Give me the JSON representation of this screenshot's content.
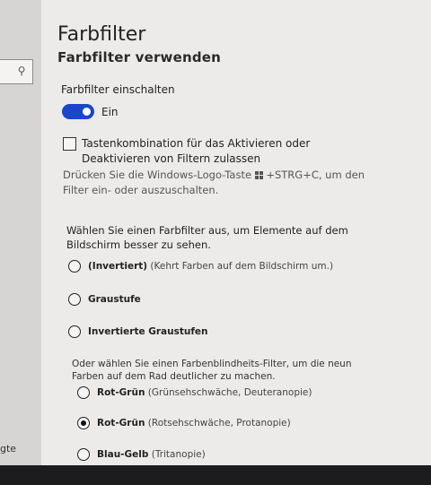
{
  "sidebar": {
    "search_icon": "search-icon",
    "cut_text": "gte"
  },
  "page": {
    "title": "Farbfilter",
    "section_title": "Farbfilter verwenden"
  },
  "toggle": {
    "label": "Farbfilter einschalten",
    "state_text": "Ein",
    "on": true,
    "accent": "#1c46c9"
  },
  "shortcut": {
    "checkbox_label": "Tastenkombination für das Aktivieren oder Deaktivieren von Filtern zulassen",
    "checked": false,
    "desc_before": "Drücken Sie die Windows-Logo-Taste",
    "desc_after": "+STRG+C, um den Filter ein- oder auszuschalten.",
    "icon": "windows-logo-icon"
  },
  "filters": {
    "choose_label": "Wählen Sie einen Farbfilter aus, um Elemente auf dem Bildschirm besser zu sehen.",
    "options": [
      {
        "name": "(Invertiert)",
        "desc": "(Kehrt Farben auf dem Bildschirm um.)",
        "checked": false
      },
      {
        "name": "Graustufe",
        "desc": "",
        "checked": false
      },
      {
        "name": "Invertierte Graustufen",
        "desc": "",
        "checked": false
      }
    ],
    "cb_label": "Oder wählen Sie einen Farbenblindheits-Filter, um die neun Farben auf dem Rad deutlicher zu machen.",
    "cb_options": [
      {
        "name": "Rot-Grün",
        "desc": "(Grünsehschwäche, Deuteranopie)",
        "checked": false
      },
      {
        "name": "Rot-Grün",
        "desc": "(Rotsehschwäche, Protanopie)",
        "checked": true
      },
      {
        "name": "Blau-Gelb",
        "desc": "(Tritanopie)",
        "checked": false
      }
    ]
  }
}
